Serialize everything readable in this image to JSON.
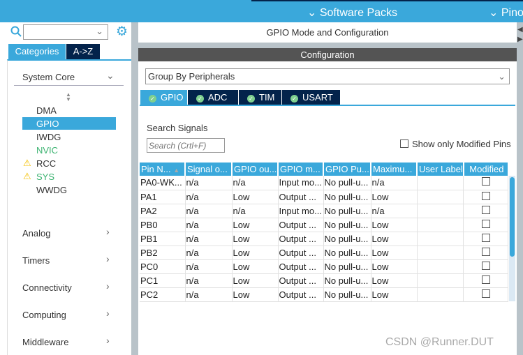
{
  "topbar": {
    "software_packs": "Software Packs",
    "pinout": "Pinout"
  },
  "left": {
    "tabs": [
      "Categories",
      "A->Z"
    ],
    "categories": [
      {
        "label": "System Core",
        "expanded": true
      },
      {
        "label": "Analog"
      },
      {
        "label": "Timers"
      },
      {
        "label": "Connectivity"
      },
      {
        "label": "Computing"
      },
      {
        "label": "Middleware"
      }
    ],
    "items": [
      {
        "label": "DMA",
        "color": "#333333"
      },
      {
        "label": "GPIO",
        "color": "#ffffff",
        "selected": true
      },
      {
        "label": "IWDG",
        "color": "#333333"
      },
      {
        "label": "NVIC",
        "color": "#3cb371"
      },
      {
        "label": "RCC",
        "color": "#333333",
        "warning": true
      },
      {
        "label": "SYS",
        "color": "#3cb371",
        "warning": true
      },
      {
        "label": "WWDG",
        "color": "#333333"
      }
    ]
  },
  "main": {
    "mode_title": "GPIO Mode and Configuration",
    "config_title": "Configuration",
    "group_by": "Group By Peripherals",
    "tabs": [
      "GPIO",
      "ADC",
      "TIM",
      "USART"
    ],
    "search_label": "Search Signals",
    "search_placeholder": "Search (Crtl+F)",
    "show_modified": "Show only Modified Pins",
    "columns": [
      "Pin N...",
      "Signal o...",
      "GPIO ou...",
      "GPIO m...",
      "GPIO Pu...",
      "Maximu...",
      "User Label",
      "Modified"
    ],
    "rows": [
      [
        "PA0-WK...",
        "n/a",
        "n/a",
        "Input mo...",
        "No pull-u...",
        "n/a",
        ""
      ],
      [
        "PA1",
        "n/a",
        "Low",
        "Output ...",
        "No pull-u...",
        "Low",
        ""
      ],
      [
        "PA2",
        "n/a",
        "n/a",
        "Input mo...",
        "No pull-u...",
        "n/a",
        ""
      ],
      [
        "PB0",
        "n/a",
        "Low",
        "Output ...",
        "No pull-u...",
        "Low",
        ""
      ],
      [
        "PB1",
        "n/a",
        "Low",
        "Output ...",
        "No pull-u...",
        "Low",
        ""
      ],
      [
        "PB2",
        "n/a",
        "Low",
        "Output ...",
        "No pull-u...",
        "Low",
        ""
      ],
      [
        "PC0",
        "n/a",
        "Low",
        "Output ...",
        "No pull-u...",
        "Low",
        ""
      ],
      [
        "PC1",
        "n/a",
        "Low",
        "Output ...",
        "No pull-u...",
        "Low",
        ""
      ],
      [
        "PC2",
        "n/a",
        "Low",
        "Output ...",
        "No pull-u...",
        "Low",
        ""
      ]
    ]
  },
  "watermark": "CSDN @Runner.DUT"
}
